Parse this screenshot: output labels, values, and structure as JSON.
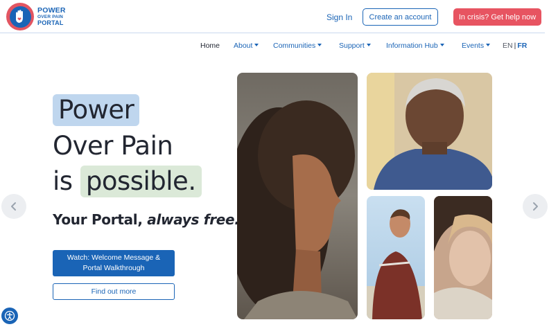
{
  "brand": {
    "line1": "POWER",
    "line2": "OVER PAIN",
    "line3": "PORTAL",
    "colors": {
      "primary": "#1a64b6",
      "crisis": "#e75461"
    }
  },
  "header": {
    "sign_in": "Sign In",
    "create_account": "Create an account",
    "crisis": "In crisis? Get help now"
  },
  "nav": {
    "items": [
      {
        "label": "Home",
        "dropdown": false
      },
      {
        "label": "About",
        "dropdown": true
      },
      {
        "label": "Communities",
        "dropdown": true
      },
      {
        "label": "Support",
        "dropdown": true
      },
      {
        "label": "Information Hub",
        "dropdown": true
      },
      {
        "label": "Events",
        "dropdown": true
      }
    ],
    "lang": {
      "en": "EN",
      "sep": "|",
      "fr": "FR"
    }
  },
  "hero": {
    "line1": "Power",
    "line2": "Over Pain",
    "line3_word": "is",
    "line3_highlight": "possible.",
    "tagline_plain": "Your Portal,",
    "tagline_italic": "always free.",
    "watch_button": "Watch: Welcome Message & Portal Walkthrough",
    "more_button": "Find out more"
  },
  "icons": {
    "logo": "hand-heart-icon",
    "prev": "chevron-left-icon",
    "next": "chevron-right-icon",
    "accessibility": "accessibility-icon"
  }
}
